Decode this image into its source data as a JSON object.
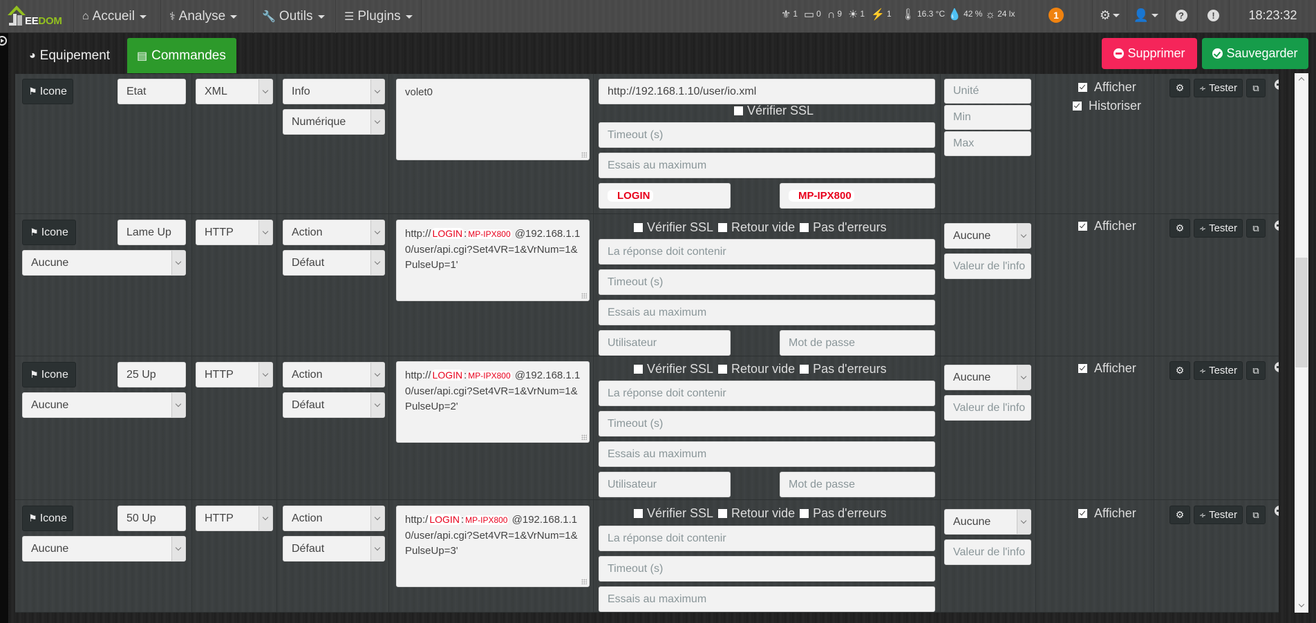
{
  "navbar": {
    "brand": {
      "prefix": "EE",
      "suffix": "DOM"
    },
    "menu": [
      {
        "label": "Accueil",
        "icon": "home-icon"
      },
      {
        "label": "Analyse",
        "icon": "stethoscope-icon"
      },
      {
        "label": "Outils",
        "icon": "wrench-icon"
      },
      {
        "label": "Plugins",
        "icon": "tasks-icon"
      }
    ],
    "stats": [
      {
        "icon": "alarm-icon",
        "value": "1"
      },
      {
        "icon": "door-icon",
        "value": "0"
      },
      {
        "icon": "shutter-icon",
        "value": "9"
      },
      {
        "icon": "lightbulb-icon",
        "value": "1"
      },
      {
        "icon": "plug-icon",
        "value": "1"
      },
      {
        "icon": "thermometer-icon",
        "value": "16.3 °C"
      },
      {
        "icon": "humidity-icon",
        "value": "42 %"
      },
      {
        "icon": "sun-icon",
        "value": "24 lx"
      }
    ],
    "notification_count": "1",
    "clock": "18:23:32"
  },
  "tabs": [
    {
      "label": "Equipement",
      "active": false
    },
    {
      "label": "Commandes",
      "active": true
    }
  ],
  "actions": {
    "delete_label": "Supprimer",
    "save_label": "Sauvegarder",
    "accent_delete": "#f5255a",
    "accent_save": "#169c4a"
  },
  "common": {
    "icon_button": "Icone",
    "test_button": "Tester",
    "verify_ssl": "Vérifier SSL",
    "empty_return": "Retour vide",
    "no_errors": "Pas d'erreurs",
    "show": "Afficher",
    "historize": "Historiser",
    "ph_timeout": "Timeout (s)",
    "ph_retries": "Essais au maximum",
    "ph_response": "La réponse doit contenir",
    "ph_user": "Utilisateur",
    "ph_password": "Mot de passe",
    "ph_unit": "Unité",
    "ph_min": "Min",
    "ph_max": "Max",
    "ph_info_value": "Valeur de l'info"
  },
  "commands": [
    {
      "name": "Etat",
      "request_type": "XML",
      "type": "Info",
      "subtype": "Numérique",
      "request": "volet0",
      "url": "http://192.168.1.10/user/io.xml",
      "verify_ssl": false,
      "user": "LOGIN",
      "password": "MP-IPX800",
      "show": true,
      "historize": true
    },
    {
      "name": "Lame Up",
      "request_type": "HTTP",
      "type": "Action",
      "subtype": "Défaut",
      "generic": "Aucune",
      "request_prefix": "http://",
      "request_user": "LOGIN",
      "request_sep": ":",
      "request_pass": "MP-IPX800",
      "request_suffix": "@192.168.1.10/user/api.cgi?Set4VR=1&VrNum=1&PulseUp=1'",
      "verify_ssl": false,
      "empty_return": false,
      "no_errors": false,
      "value_select": "Aucune",
      "show": true
    },
    {
      "name": "25 Up",
      "request_type": "HTTP",
      "type": "Action",
      "subtype": "Défaut",
      "generic": "Aucune",
      "request_prefix": "http://",
      "request_user": "LOGIN",
      "request_sep": ":",
      "request_pass": "MP-IPX800",
      "request_suffix": "@192.168.1.10/user/api.cgi?Set4VR=1&VrNum=1&PulseUp=2'",
      "verify_ssl": false,
      "empty_return": false,
      "no_errors": false,
      "value_select": "Aucune",
      "show": true
    },
    {
      "name": "50 Up",
      "request_type": "HTTP",
      "type": "Action",
      "subtype": "Défaut",
      "generic": "Aucune",
      "request_prefix": "http:/",
      "request_user": "LOGIN",
      "request_sep": ":",
      "request_pass": "MP-IPX800",
      "request_suffix": "@192.168.1.10/user/api.cgi?Set4VR=1&VrNum=1&PulseUp=3'",
      "verify_ssl": false,
      "empty_return": false,
      "no_errors": false,
      "value_select": "Aucune",
      "show": true
    }
  ]
}
